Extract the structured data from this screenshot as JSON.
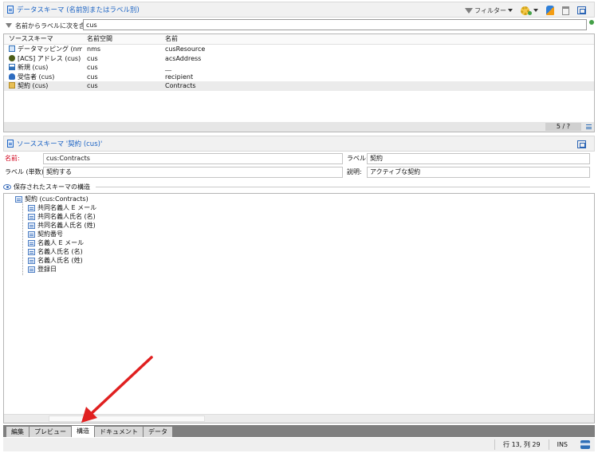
{
  "top_panel": {
    "title": "データスキーマ (名前別またはラベル別)",
    "toolbar": {
      "filter_label": "フィルター",
      "icons": [
        "filter-icon",
        "gear-add-icon",
        "pin-icon",
        "trash-icon",
        "maximize-icon"
      ]
    },
    "search": {
      "label": "名前からラベルに次を含む:",
      "value": "cus"
    },
    "list": {
      "columns": [
        "ソーススキーマ",
        "名前空間",
        "名前"
      ],
      "rows": [
        {
          "source": "データマッピング (nms)",
          "namespace": "nms",
          "name": "cusResource",
          "icon": "table-icon"
        },
        {
          "source": "[ACS] アドレス (cus)",
          "namespace": "cus",
          "name": "acsAddress",
          "icon": "acs-icon"
        },
        {
          "source": "新規 (cus)",
          "namespace": "cus",
          "name": "__",
          "icon": "new-table-icon"
        },
        {
          "source": "受信者 (cus)",
          "namespace": "cus",
          "name": "recipient",
          "icon": "user-icon"
        },
        {
          "source": "契約 (cus)",
          "namespace": "cus",
          "name": "Contracts",
          "icon": "folder-icon",
          "selected": true
        }
      ],
      "count": "5 / ?"
    }
  },
  "detail_panel": {
    "title": "ソーススキーマ '契約 (cus)'",
    "name_label": "名前:",
    "name_value": "cus:Contracts",
    "label_label": "ラベル:",
    "label_value": "契約",
    "singular_label": "ラベル (単数):",
    "singular_value": "契約する",
    "description_label": "説明:",
    "description_value": "アクティブな契約",
    "structure_label": "保存されたスキーマの構造",
    "tree": {
      "root": "契約 (cus:Contracts)",
      "children": [
        "共同名義人 E メール",
        "共同名義人氏名 (名)",
        "共同名義人氏名 (姓)",
        "契約番号",
        "名義人 E メール",
        "名義人氏名 (名)",
        "名義人氏名 (姓)",
        "登録日"
      ]
    },
    "colors": {
      "required_label": "#d0021b",
      "accent": "#1b63c4",
      "arrow": "#e02020"
    }
  },
  "tabs": [
    "編集",
    "プレビュー",
    "構造",
    "ドキュメント",
    "データ"
  ],
  "active_tab": "構造",
  "status": {
    "position": "行 13, 列 29",
    "mode": "INS"
  }
}
